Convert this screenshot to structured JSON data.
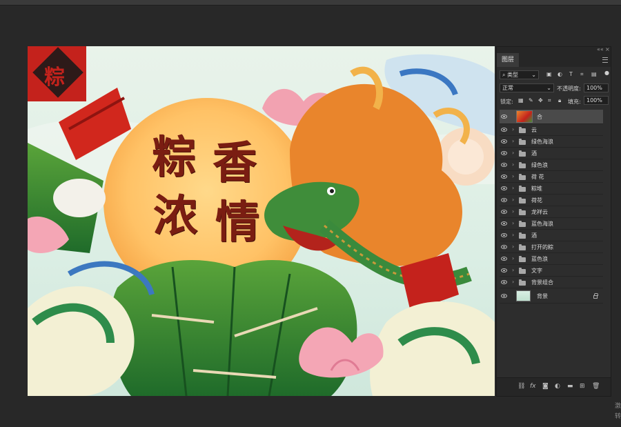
{
  "canvas": {
    "title_chars": [
      "粽",
      "香",
      "浓",
      "情"
    ],
    "lantern_char": "粽"
  },
  "panel": {
    "tab_label": "图层",
    "collapse_label": "««",
    "close_label": "×",
    "filter_label": "类型",
    "blend_mode": "正常",
    "opacity_label": "不透明度:",
    "opacity_value": "100%",
    "lock_label": "锁定:",
    "fill_label": "填充:",
    "fill_value": "100%",
    "layers": [
      {
        "name": "合",
        "kind": "image",
        "selected": true
      },
      {
        "name": "云",
        "kind": "group"
      },
      {
        "name": "绿色海浪",
        "kind": "group"
      },
      {
        "name": "酒",
        "kind": "group"
      },
      {
        "name": "绿色浪",
        "kind": "group"
      },
      {
        "name": "荷 花",
        "kind": "group"
      },
      {
        "name": "粽堆",
        "kind": "group"
      },
      {
        "name": "荷花",
        "kind": "group"
      },
      {
        "name": "龙祥云",
        "kind": "group"
      },
      {
        "name": "蓝色海浪",
        "kind": "group"
      },
      {
        "name": "酒",
        "kind": "group"
      },
      {
        "name": "打开的粽",
        "kind": "group"
      },
      {
        "name": "蓝色浪",
        "kind": "group"
      },
      {
        "name": "文字",
        "kind": "group"
      },
      {
        "name": "背景组合",
        "kind": "group"
      },
      {
        "name": "背景",
        "kind": "background",
        "locked": true
      }
    ],
    "bottom_icons": [
      "link-icon",
      "fx-icon",
      "mask-icon",
      "adjustment-icon",
      "folder-icon",
      "new-layer-icon",
      "trash-icon"
    ],
    "fx_label": "fx"
  },
  "corner_text": "激\n转"
}
